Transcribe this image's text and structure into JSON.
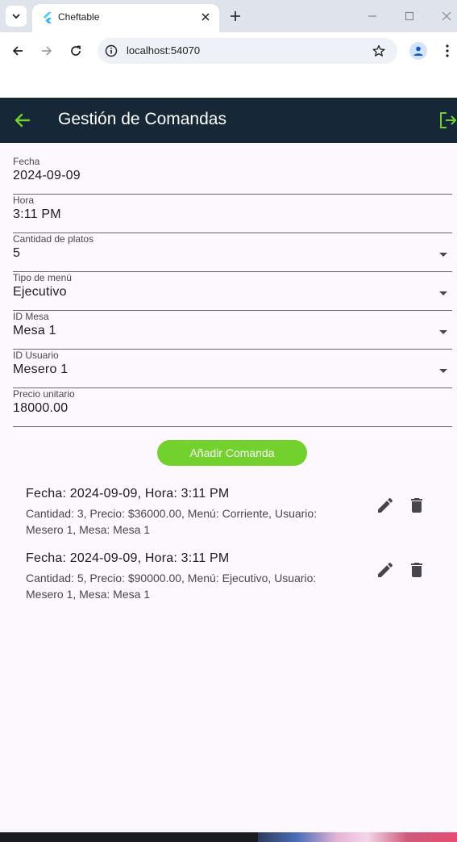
{
  "browser": {
    "tab_title": "Cheftable",
    "url": "localhost:54070"
  },
  "appbar": {
    "title": "Gestión de Comandas"
  },
  "form": {
    "fields": [
      {
        "label": "Fecha",
        "value": "2024-09-09",
        "type": "text"
      },
      {
        "label": "Hora",
        "value": "3:11 PM",
        "type": "text"
      },
      {
        "label": "Cantidad de platos",
        "value": "5",
        "type": "dropdown"
      },
      {
        "label": "Tipo de menú",
        "value": "Ejecutivo",
        "type": "dropdown"
      },
      {
        "label": "ID Mesa",
        "value": "Mesa 1",
        "type": "dropdown"
      },
      {
        "label": "ID Usuario",
        "value": "Mesero 1",
        "type": "dropdown"
      },
      {
        "label": "Precio unitario",
        "value": "18000.00",
        "type": "text"
      }
    ],
    "submit_label": "Añadir Comanda"
  },
  "orders": [
    {
      "title": "Fecha: 2024-09-09, Hora: 3:11 PM",
      "details": "Cantidad: 3, Precio: $36000.00, Menú: Corriente, Usuario: Mesero 1, Mesa: Mesa 1"
    },
    {
      "title": "Fecha: 2024-09-09, Hora: 3:11 PM",
      "details": "Cantidad: 5, Precio: $90000.00, Menú: Ejecutivo, Usuario: Mesero 1, Mesa: Mesa 1"
    }
  ],
  "colors": {
    "appbar_bg": "#162738",
    "accent_green": "#72d12c",
    "page_bg": "#fdf7fe"
  }
}
